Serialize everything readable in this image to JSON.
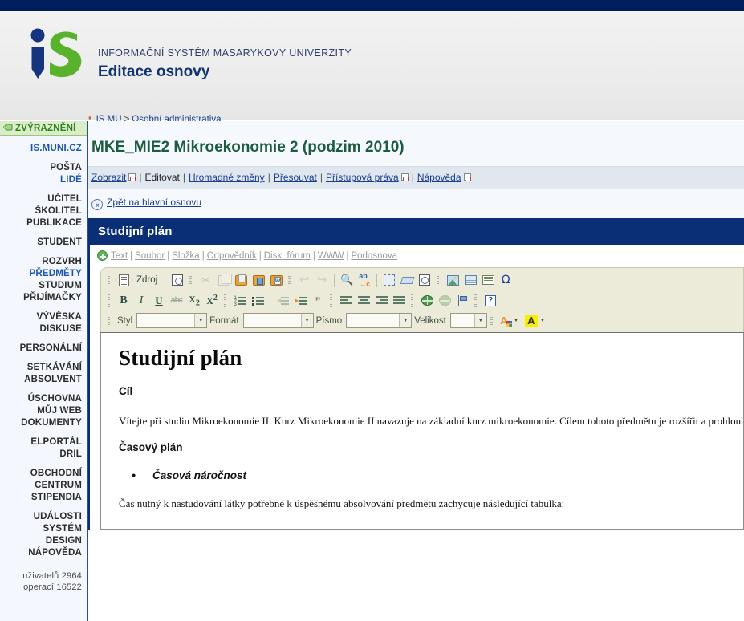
{
  "masthead": {
    "system_name": "INFORMAČNÍ SYSTÉM MASARYKOVY UNIVERZITY",
    "page_title": "Editace osnovy",
    "logo_alt": "is-logo"
  },
  "breadcrumb": {
    "item1": "IS MU",
    "separator": ">",
    "item2": "Osobní administrativa"
  },
  "sidebar": {
    "highlight_label": "ZVÝRAZNĚNÍ",
    "groups": [
      {
        "items": [
          {
            "label": "IS.MUNI.CZ",
            "style": "blue"
          }
        ]
      },
      {
        "items": [
          {
            "label": "POŠTA",
            "style": "dark"
          },
          {
            "label": "LIDÉ",
            "style": "blue"
          }
        ]
      },
      {
        "items": [
          {
            "label": "UČITEL",
            "style": "dark"
          },
          {
            "label": "ŠKOLITEL",
            "style": "dark"
          },
          {
            "label": "PUBLIKACE",
            "style": "dark"
          }
        ]
      },
      {
        "items": [
          {
            "label": "STUDENT",
            "style": "dark"
          }
        ]
      },
      {
        "items": [
          {
            "label": "ROZVRH",
            "style": "dark"
          },
          {
            "label": "PŘEDMĚTY",
            "style": "blue"
          },
          {
            "label": "STUDIUM",
            "style": "dark"
          },
          {
            "label": "PŘIJÍMAČKY",
            "style": "dark"
          }
        ]
      },
      {
        "items": [
          {
            "label": "VÝVĚSKA",
            "style": "dark"
          },
          {
            "label": "DISKUSE",
            "style": "dark"
          }
        ]
      },
      {
        "items": [
          {
            "label": "PERSONÁLNÍ",
            "style": "dark"
          }
        ]
      },
      {
        "items": [
          {
            "label": "SETKÁVÁNÍ",
            "style": "dark"
          },
          {
            "label": "ABSOLVENT",
            "style": "dark"
          }
        ]
      },
      {
        "items": [
          {
            "label": "ÚSCHOVNA",
            "style": "dark"
          },
          {
            "label": "MŮJ WEB",
            "style": "dark"
          },
          {
            "label": "DOKUMENTY",
            "style": "dark"
          }
        ]
      },
      {
        "items": [
          {
            "label": "ELPORTÁL",
            "style": "dark"
          },
          {
            "label": "DRIL",
            "style": "dark"
          }
        ]
      },
      {
        "items": [
          {
            "label": "OBCHODNÍ",
            "style": "dark"
          },
          {
            "label": "CENTRUM",
            "style": "dark"
          },
          {
            "label": "STIPENDIA",
            "style": "dark"
          }
        ]
      },
      {
        "items": [
          {
            "label": "UDÁLOSTI",
            "style": "dark"
          },
          {
            "label": "SYSTÉM",
            "style": "dark"
          },
          {
            "label": "DESIGN",
            "style": "dark"
          },
          {
            "label": "NÁPOVĚDA",
            "style": "dark"
          }
        ]
      }
    ],
    "stats_users": "uživatelů 2964",
    "stats_ops": "operací 16522"
  },
  "main": {
    "course_title": "MKE_MIE2 Mikroekonomie 2 (podzim 2010)",
    "actions": [
      {
        "label": "Zobrazit",
        "link": true,
        "external": true
      },
      {
        "label": "Editovat",
        "link": false,
        "external": false
      },
      {
        "label": "Hromadné změny",
        "link": true,
        "external": false
      },
      {
        "label": "Přesouvat",
        "link": true,
        "external": false
      },
      {
        "label": "Přístupová práva",
        "link": true,
        "external": true
      },
      {
        "label": "Nápověda",
        "link": true,
        "external": true
      }
    ],
    "back_link": "Zpět na hlavní osnovu",
    "panel_title": "Studijní plán",
    "add_items": [
      "Text",
      "Soubor",
      "Složka",
      "Odpovědník",
      "Disk. fórum",
      "WWW",
      "Podosnova"
    ]
  },
  "editor": {
    "toolbar_row1": [
      {
        "name": "source-button",
        "label": "Zdroj",
        "kind": "text"
      },
      {
        "name": "preview-icon",
        "kind": "preview"
      },
      {
        "name": "cut-icon",
        "kind": "cut",
        "dim": true
      },
      {
        "name": "copy-icon",
        "kind": "copy",
        "dim": true
      },
      {
        "name": "paste-icon",
        "kind": "paste"
      },
      {
        "name": "paste-as-plain-text-icon",
        "kind": "paste-plain"
      },
      {
        "name": "paste-from-word-icon",
        "kind": "paste-word"
      },
      {
        "name": "undo-icon",
        "kind": "undo",
        "dim": true
      },
      {
        "name": "redo-icon",
        "kind": "redo",
        "dim": true
      },
      {
        "name": "find-icon",
        "kind": "find"
      },
      {
        "name": "replace-icon",
        "kind": "replace"
      },
      {
        "name": "select-all-icon",
        "kind": "selectall"
      },
      {
        "name": "remove-format-icon",
        "kind": "eraser"
      },
      {
        "name": "spellcheck-icon",
        "kind": "spell"
      },
      {
        "name": "insert-image-icon",
        "kind": "image"
      },
      {
        "name": "insert-table-icon",
        "kind": "table"
      },
      {
        "name": "horizontal-rule-icon",
        "kind": "hr"
      },
      {
        "name": "special-character-icon",
        "kind": "omega"
      }
    ],
    "toolbar_row2": [
      {
        "name": "bold-button",
        "label": "B"
      },
      {
        "name": "italic-button",
        "label": "I"
      },
      {
        "name": "underline-button",
        "label": "U"
      },
      {
        "name": "strikethrough-button",
        "label": "abc"
      },
      {
        "name": "subscript-button",
        "label": "X2"
      },
      {
        "name": "superscript-button",
        "label": "X2"
      },
      {
        "name": "numbered-list-button",
        "label": ""
      },
      {
        "name": "bulleted-list-button",
        "label": ""
      },
      {
        "name": "decrease-indent-button",
        "label": ""
      },
      {
        "name": "increase-indent-button",
        "label": ""
      },
      {
        "name": "blockquote-button",
        "label": "”"
      },
      {
        "name": "align-left-button",
        "label": ""
      },
      {
        "name": "align-center-button",
        "label": ""
      },
      {
        "name": "align-right-button",
        "label": ""
      },
      {
        "name": "justify-button",
        "label": ""
      },
      {
        "name": "insert-link-button",
        "label": ""
      },
      {
        "name": "unlink-button",
        "label": ""
      },
      {
        "name": "anchor-button",
        "label": ""
      },
      {
        "name": "about-button",
        "label": "?"
      }
    ],
    "styles_label": "Styl",
    "styles_value": "",
    "format_label": "Formát",
    "format_value": "",
    "font_label": "Písmo",
    "font_value": "",
    "size_label": "Velikost",
    "size_value": "",
    "text_color_glyph": "A",
    "bg_color_glyph": "A",
    "bg_color_hex": "#f6f000"
  },
  "document": {
    "h1": "Studijní plán",
    "section1_heading": "Cíl",
    "section1_paragraph": "Vítejte při studiu Mikroekonomie II. Kurz Mikroekonomie II navazuje na základní kurz mikroekonomie. Cílem tohoto předmětu je rozšířit a prohloubit znalosti základních mikroekonomických principů a naučit se aplikovat matematické metody. V úvodní části kurzu se seznámíte s chováním spotřebitele a utvářením rovnováhy spotřebitele na trhu statků a služeb. Dále se budete věnovat problematice rozhodování jak jednotlivců tak firem o množství nabízených a poptávaných výrobních faktorů na trhu práce a kapitálovém trhu. Věřím, že Vás studium bude bavit a podnítí tvůrčí ekonomické myšlení. Znalosti získané v předmětu Vám pomohou pochopit a vysvětlit podněty, které stojí za chováním ekonomických subjektů.",
    "section2_heading": "Časový plán",
    "bullet1": "Časová náročnost",
    "section2_paragraph": "Čas nutný k nastudování látky potřebné k úspěšnému absolvování předmětu zachycuje následující tabulka:"
  },
  "colors": {
    "navy": "#001f5c",
    "panel_navy": "#0b2f77",
    "green_title": "#1d5c3f",
    "link_blue": "#1a3f8f",
    "highlight_green": "#d9edc8",
    "toolbar_beige": "#ecebda"
  }
}
